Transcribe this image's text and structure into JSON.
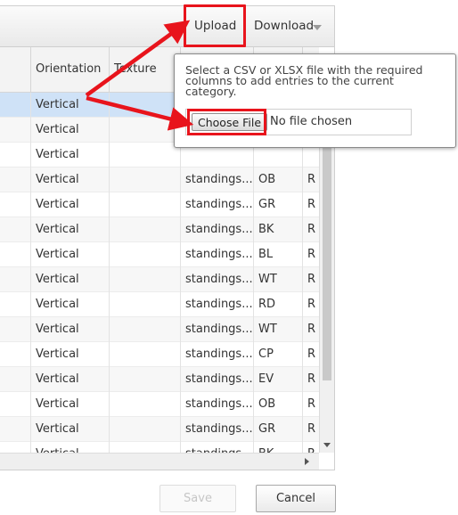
{
  "toolbar": {
    "upload_label": "Upload",
    "download_label": "Download",
    "download_icon": "caret-down-icon"
  },
  "columns": [
    "Orientation",
    "Texture"
  ],
  "rows": [
    {
      "orientation": "Vertical",
      "col3": "",
      "col4": "",
      "col5": ""
    },
    {
      "orientation": "Vertical",
      "col3": "",
      "col4": "",
      "col5": ""
    },
    {
      "orientation": "Vertical",
      "col3": "",
      "col4": "",
      "col5": ""
    },
    {
      "orientation": "Vertical",
      "col3": "standings...",
      "col4": "OB",
      "col5": "R"
    },
    {
      "orientation": "Vertical",
      "col3": "standings...",
      "col4": "GR",
      "col5": "R"
    },
    {
      "orientation": "Vertical",
      "col3": "standings...",
      "col4": "BK",
      "col5": "R"
    },
    {
      "orientation": "Vertical",
      "col3": "standings...",
      "col4": "BL",
      "col5": "R"
    },
    {
      "orientation": "Vertical",
      "col3": "standings...",
      "col4": "WT",
      "col5": "R"
    },
    {
      "orientation": "Vertical",
      "col3": "standings...",
      "col4": "RD",
      "col5": "R"
    },
    {
      "orientation": "Vertical",
      "col3": "standings...",
      "col4": "WT",
      "col5": "R"
    },
    {
      "orientation": "Vertical",
      "col3": "standings...",
      "col4": "CP",
      "col5": "R"
    },
    {
      "orientation": "Vertical",
      "col3": "standings...",
      "col4": "EV",
      "col5": "R"
    },
    {
      "orientation": "Vertical",
      "col3": "standings...",
      "col4": "OB",
      "col5": "R"
    },
    {
      "orientation": "Vertical",
      "col3": "standings...",
      "col4": "GR",
      "col5": "R"
    },
    {
      "orientation": "Vertical",
      "col3": "standings...",
      "col4": "BK",
      "col5": "R"
    }
  ],
  "popover": {
    "text": "Select a CSV or XLSX file with the required columns to add entries to the current category.",
    "choose_file_label": "Choose File",
    "no_file_text": "No file chosen"
  },
  "footer": {
    "save_label": "Save",
    "cancel_label": "Cancel"
  },
  "colors": {
    "highlight": "#e8141c",
    "selected_row": "#cfe2f7"
  }
}
